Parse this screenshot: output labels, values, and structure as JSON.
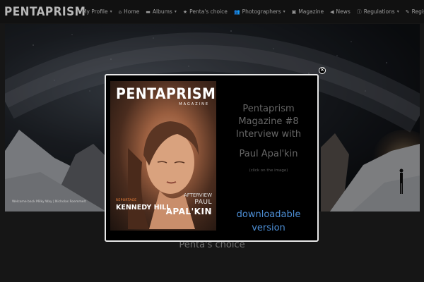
{
  "site": {
    "logo": "PENTAPRISM"
  },
  "nav": [
    {
      "label": "My Profile",
      "icon": "",
      "caret": true
    },
    {
      "label": "Home",
      "icon": "home-icon",
      "caret": false
    },
    {
      "label": "Albums",
      "icon": "folder-icon",
      "caret": true
    },
    {
      "label": "Penta's choice",
      "icon": "star-icon",
      "caret": false
    },
    {
      "label": "Photographers",
      "icon": "users-icon",
      "caret": true
    },
    {
      "label": "Magazine",
      "icon": "book-icon",
      "caret": false
    },
    {
      "label": "News",
      "icon": "bullhorn-icon",
      "caret": false
    },
    {
      "label": "Regulations",
      "icon": "info-icon",
      "caret": true
    },
    {
      "label": "Register",
      "icon": "pencil-icon",
      "caret": true
    }
  ],
  "hero": {
    "caption": "Welcome back Milky Way | Nicholas Roemmelt"
  },
  "section": {
    "title": "Penta's choice"
  },
  "modal": {
    "cover": {
      "title": "PENTAPRISM",
      "subtitle": "MAGAZINE",
      "left_kicker": "REPORTAGE",
      "left_name": "KENNEDY HILL",
      "right_kicker": "AFTERVIEW",
      "right_name_1": "PAUL",
      "right_name_2": "APAL'KIN"
    },
    "lines": [
      "Pentaprism",
      "Magazine #8",
      "Interview with",
      "Paul Apal'kin"
    ],
    "hint": "(click on the image)",
    "download": [
      "downloadable",
      "version"
    ]
  },
  "colors": {
    "background": "#161616",
    "link": "#4d8fd6",
    "modal_border": "#e8e8e8"
  }
}
